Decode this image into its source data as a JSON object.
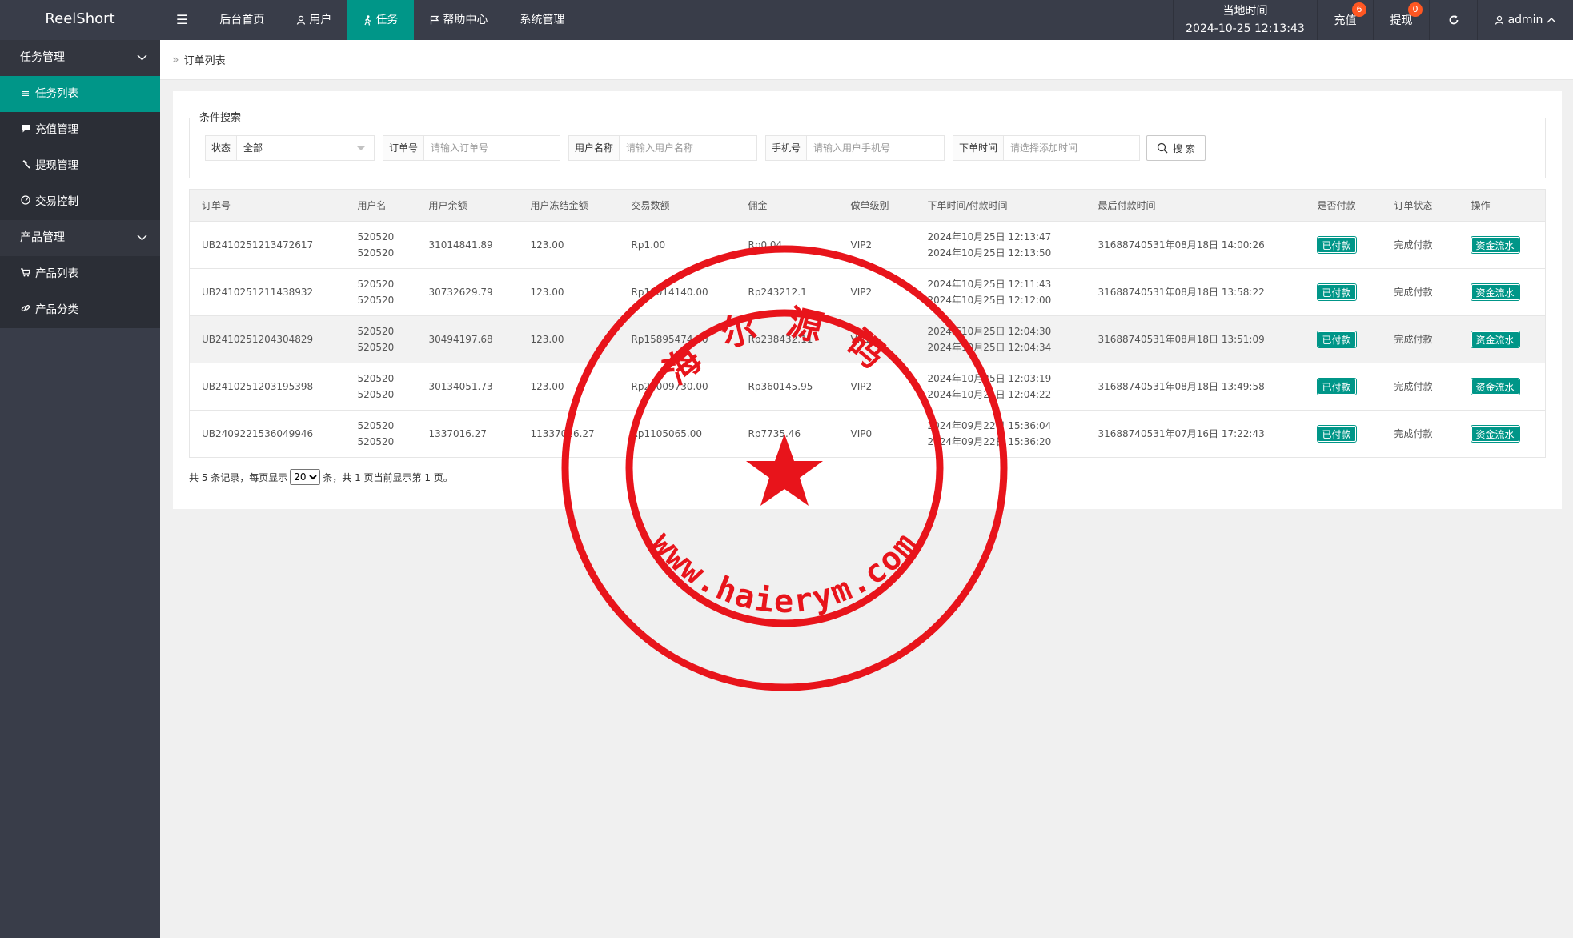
{
  "app": {
    "title": "ReelShort"
  },
  "topnav": {
    "toggle_icon": "menu-icon",
    "items": [
      {
        "label": "后台首页",
        "icon": ""
      },
      {
        "label": "用户",
        "icon": "user-icon"
      },
      {
        "label": "任务",
        "icon": "walk-icon"
      },
      {
        "label": "帮助中心",
        "icon": "flag-icon"
      },
      {
        "label": "系统管理",
        "icon": ""
      }
    ],
    "active_index": 2
  },
  "topright": {
    "time_label": "当地时间",
    "time_value": "2024-10-25 12:13:43",
    "recharge_label": "充值",
    "recharge_badge": "6",
    "withdraw_label": "提现",
    "withdraw_badge": "0",
    "refresh_icon": "refresh-icon",
    "admin_label": "admin"
  },
  "sidebar": {
    "groups": [
      {
        "label": "任务管理",
        "items": [
          {
            "label": "任务列表",
            "icon": "list-icon",
            "active": true
          },
          {
            "label": "充值管理",
            "icon": "chat-icon",
            "active": false
          },
          {
            "label": "提现管理",
            "icon": "gavel-icon",
            "active": false
          },
          {
            "label": "交易控制",
            "icon": "gauge-icon",
            "active": false
          }
        ]
      },
      {
        "label": "产品管理",
        "items": [
          {
            "label": "产品列表",
            "icon": "cart-icon",
            "active": false
          },
          {
            "label": "产品分类",
            "icon": "link-icon",
            "active": false
          }
        ]
      }
    ]
  },
  "breadcrumb": {
    "current": "订单列表"
  },
  "search": {
    "legend": "条件搜索",
    "status_label": "状态",
    "status_value": "全部",
    "order_label": "订单号",
    "order_placeholder": "请输入订单号",
    "username_label": "用户名称",
    "username_placeholder": "请输入用户名称",
    "phone_label": "手机号",
    "phone_placeholder": "请输入用户手机号",
    "time_label": "下单时间",
    "time_placeholder": "请选择添加时间",
    "button_label": "搜 索"
  },
  "table": {
    "headers": [
      "订单号",
      "用户名",
      "用户余额",
      "用户冻结金额",
      "交易数额",
      "佣金",
      "做单级别",
      "下单时间/付款时间",
      "最后付款时间",
      "是否付款",
      "订单状态",
      "操作"
    ],
    "rows": [
      {
        "order": "UB2410251213472617",
        "user1": "520520",
        "user2": "520520",
        "balance": "31014841.89",
        "frozen": "123.00",
        "amount": "Rp1.00",
        "commission": "Rp0.04",
        "level": "VIP2",
        "time1": "2024年10月25日 12:13:47",
        "time2": "2024年10月25日 12:13:50",
        "last_pay": "31688740531年08月18日 14:00:26",
        "paid": "已付款",
        "status": "完成付款",
        "action": "资金流水"
      },
      {
        "order": "UB2410251211438932",
        "user1": "520520",
        "user2": "520520",
        "balance": "30732629.79",
        "frozen": "123.00",
        "amount": "Rp18014140.00",
        "commission": "Rp243212.1",
        "level": "VIP2",
        "time1": "2024年10月25日 12:11:43",
        "time2": "2024年10月25日 12:12:00",
        "last_pay": "31688740531年08月18日 13:58:22",
        "paid": "已付款",
        "status": "完成付款",
        "action": "资金流水"
      },
      {
        "order": "UB2410251204304829",
        "user1": "520520",
        "user2": "520520",
        "balance": "30494197.68",
        "frozen": "123.00",
        "amount": "Rp15895474.00",
        "commission": "Rp238432.11",
        "level": "VIP2",
        "time1": "2024年10月25日 12:04:30",
        "time2": "2024年10月25日 12:04:34",
        "last_pay": "31688740531年08月18日 13:51:09",
        "paid": "已付款",
        "status": "完成付款",
        "action": "资金流水"
      },
      {
        "order": "UB2410251203195398",
        "user1": "520520",
        "user2": "520520",
        "balance": "30134051.73",
        "frozen": "123.00",
        "amount": "Rp24009730.00",
        "commission": "Rp360145.95",
        "level": "VIP2",
        "time1": "2024年10月25日 12:03:19",
        "time2": "2024年10月25日 12:04:22",
        "last_pay": "31688740531年08月18日 13:49:58",
        "paid": "已付款",
        "status": "完成付款",
        "action": "资金流水"
      },
      {
        "order": "UB2409221536049946",
        "user1": "520520",
        "user2": "520520",
        "balance": "1337016.27",
        "frozen": "11337016.27",
        "amount": "Rp1105065.00",
        "commission": "Rp7735.46",
        "level": "VIP0",
        "time1": "2024年09月22日 15:36:04",
        "time2": "2024年09月22日 15:36:20",
        "last_pay": "31688740531年07月16日 17:22:43",
        "paid": "已付款",
        "status": "完成付款",
        "action": "资金流水"
      }
    ]
  },
  "pager": {
    "prefix": "共 5 条记录，每页显示",
    "page_size": "20",
    "suffix": "条，共 1 页当前显示第 1 页。"
  },
  "stamp": {
    "top_text": "海尔源码",
    "bottom_text": "www.haierym.com",
    "color": "#e8141b"
  },
  "colors": {
    "accent": "#009688",
    "topbar": "#393d49",
    "badge": "#ff5722"
  }
}
